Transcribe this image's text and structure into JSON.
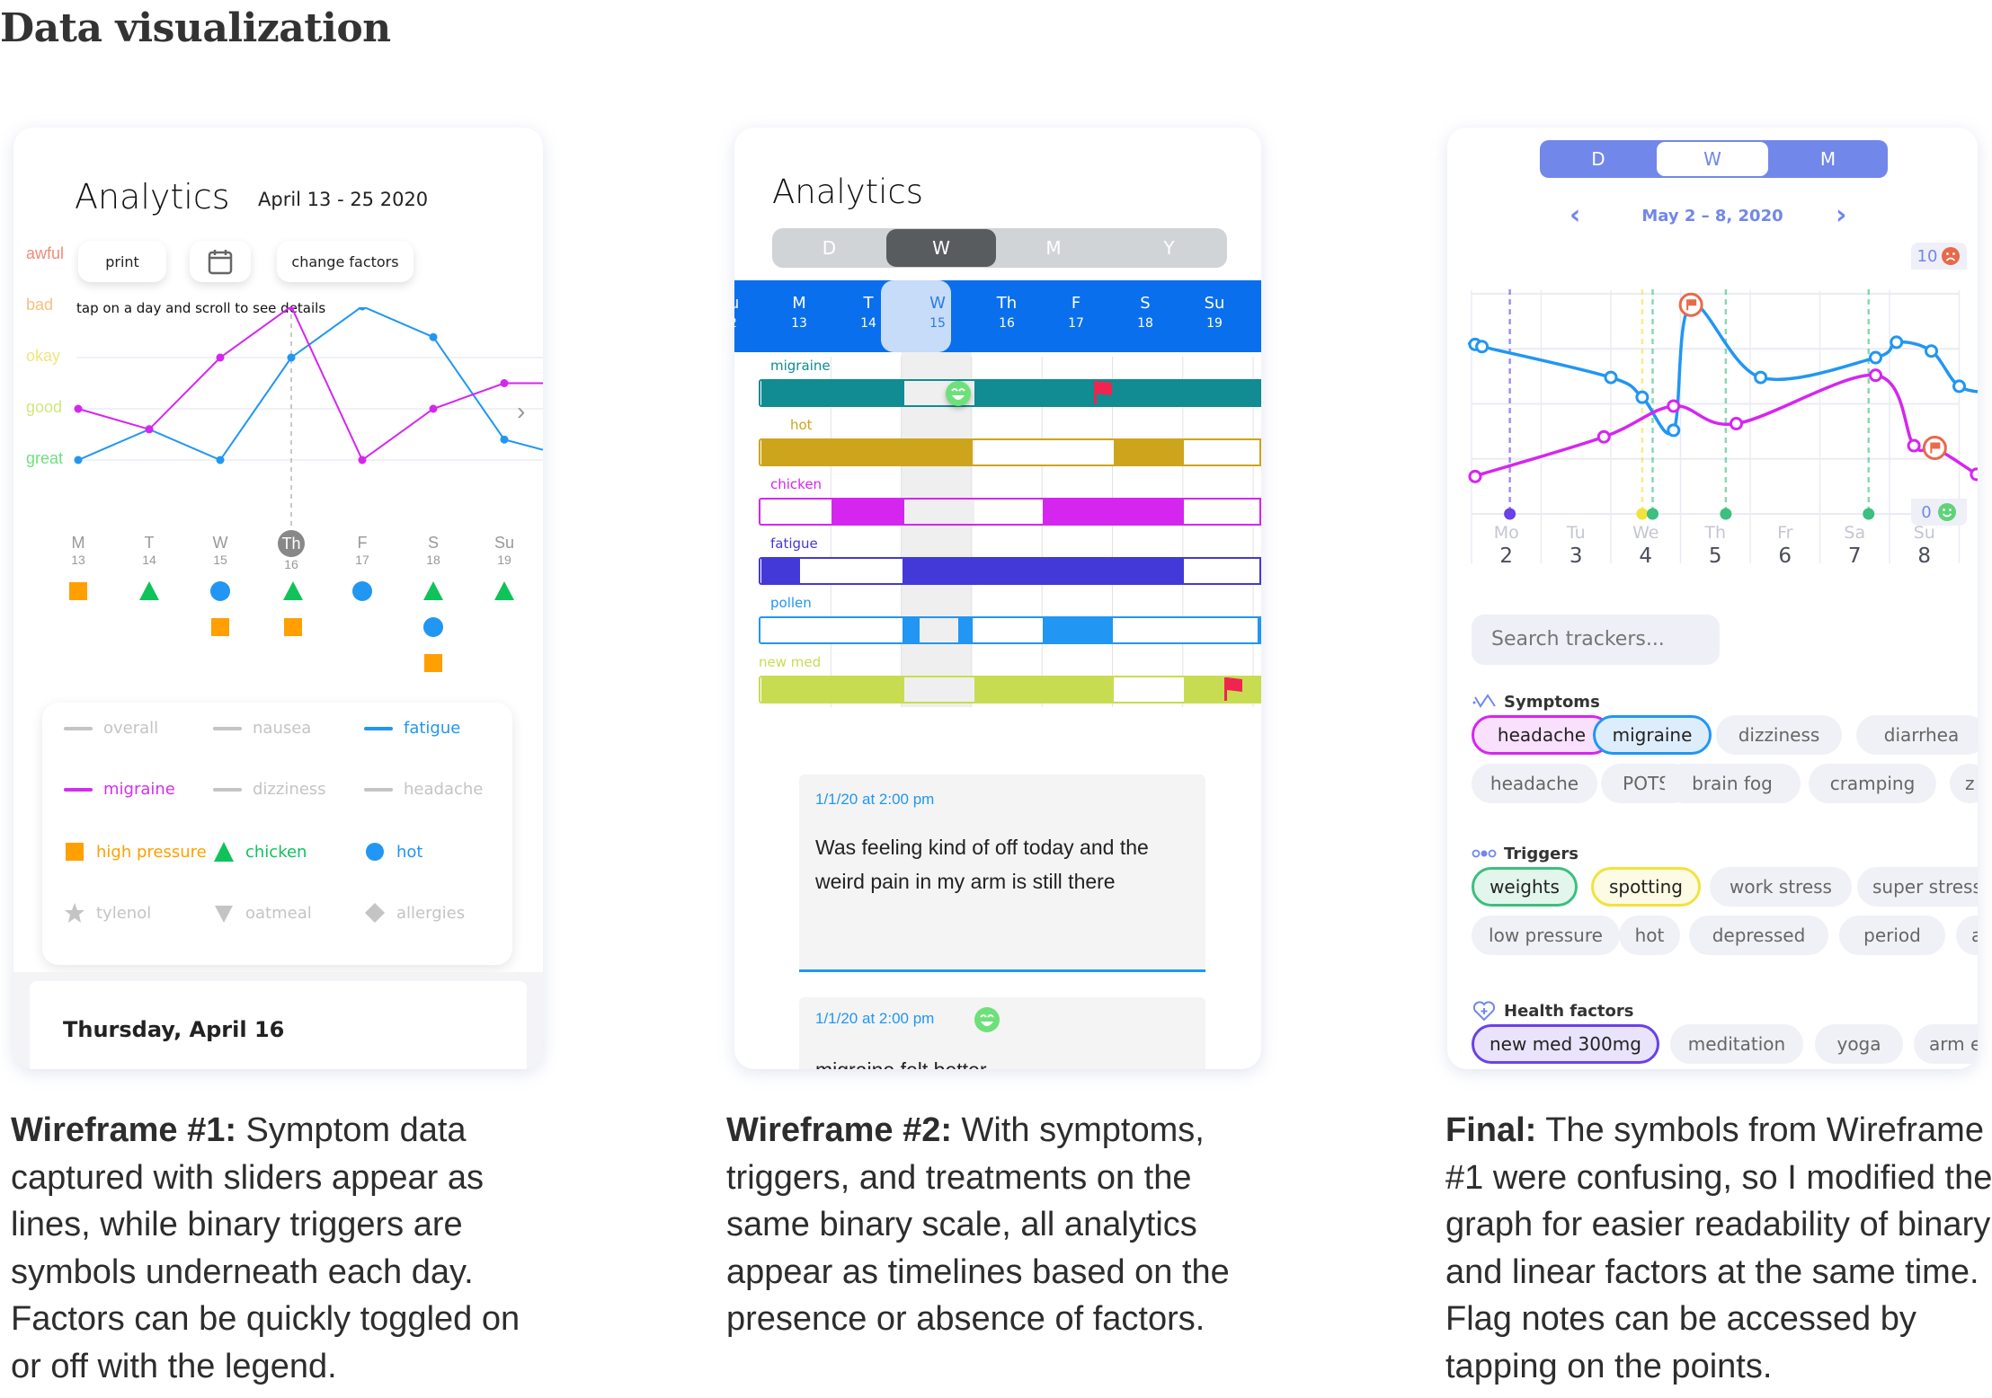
{
  "page": {
    "title": "Data visualization"
  },
  "wireframe1": {
    "title": "Analytics",
    "date_range": "April 13 - 25 2020",
    "buttons": {
      "print": "print",
      "calendar_icon": "calendar-icon",
      "change_factors": "change factors"
    },
    "hint": "tap on a day and scroll to see details",
    "scale": [
      {
        "label": "awful",
        "color": "#f28b7a"
      },
      {
        "label": "bad",
        "color": "#f7c07e"
      },
      {
        "label": "okay",
        "color": "#f2e47e"
      },
      {
        "label": "good",
        "color": "#cfe77a"
      },
      {
        "label": "great",
        "color": "#6fe07e"
      }
    ],
    "days": [
      {
        "d": "M",
        "n": "13"
      },
      {
        "d": "T",
        "n": "14"
      },
      {
        "d": "W",
        "n": "15"
      },
      {
        "d": "Th",
        "n": "16",
        "selected": true
      },
      {
        "d": "F",
        "n": "17"
      },
      {
        "d": "S",
        "n": "18"
      },
      {
        "d": "Su",
        "n": "19"
      }
    ],
    "day_symbols": [
      [
        "high pressure"
      ],
      [
        "chicken"
      ],
      [
        "hot",
        "high pressure"
      ],
      [
        "chicken",
        "high pressure"
      ],
      [
        "hot"
      ],
      [
        "chicken",
        "hot",
        "high pressure"
      ],
      [
        "chicken"
      ]
    ],
    "legend": [
      {
        "label": "overall",
        "kind": "line",
        "active": false,
        "color": "#c4c4c4"
      },
      {
        "label": "nausea",
        "kind": "line",
        "active": false,
        "color": "#c4c4c4"
      },
      {
        "label": "fatigue",
        "kind": "line",
        "active": true,
        "color": "#2196f3"
      },
      {
        "label": "migraine",
        "kind": "line",
        "active": true,
        "color": "#d32ef0"
      },
      {
        "label": "dizziness",
        "kind": "line",
        "active": false,
        "color": "#c4c4c4"
      },
      {
        "label": "headache",
        "kind": "line",
        "active": false,
        "color": "#c4c4c4"
      },
      {
        "label": "high pressure",
        "kind": "square",
        "active": true,
        "color": "#ff9f00"
      },
      {
        "label": "chicken",
        "kind": "triangle",
        "active": true,
        "color": "#0fc35a"
      },
      {
        "label": "hot",
        "kind": "circle",
        "active": true,
        "color": "#2196f3"
      },
      {
        "label": "tylenol",
        "kind": "star",
        "active": false,
        "color": "#c4c4c4"
      },
      {
        "label": "oatmeal",
        "kind": "down-triangle",
        "active": false,
        "color": "#c4c4c4"
      },
      {
        "label": "allergies",
        "kind": "diamond",
        "active": false,
        "color": "#c4c4c4"
      }
    ],
    "detail_title": "Thursday, April 16"
  },
  "wireframe2": {
    "title": "Analytics",
    "range_tabs": [
      "D",
      "W",
      "M",
      "Y"
    ],
    "active_tab": "W",
    "week": [
      {
        "d": "M",
        "n": "13"
      },
      {
        "d": "T",
        "n": "14"
      },
      {
        "d": "W",
        "n": "15",
        "selected": true
      },
      {
        "d": "Th",
        "n": "16"
      },
      {
        "d": "F",
        "n": "17"
      },
      {
        "d": "S",
        "n": "18"
      },
      {
        "d": "Su",
        "n": "19"
      }
    ],
    "timelines": [
      {
        "label": "migraine",
        "color": "#108c92"
      },
      {
        "label": "hot",
        "color": "#cda51c"
      },
      {
        "label": "chicken",
        "color": "#d526ef"
      },
      {
        "label": "fatigue",
        "color": "#4338d8"
      },
      {
        "label": "pollen",
        "color": "#2196f3"
      },
      {
        "label": "new med",
        "color": "#c8dc52"
      }
    ],
    "notes": [
      {
        "timestamp": "1/1/20 at 2:00 pm",
        "body": "Was feeling kind of off today and the weird pain in my arm is still there"
      },
      {
        "timestamp": "1/1/20 at 2:00 pm",
        "body": "migraine felt better",
        "mood": "happy-face-icon"
      }
    ]
  },
  "final": {
    "range_tabs": [
      "D",
      "W",
      "M"
    ],
    "active_tab": "W",
    "date_range": "May 2 – 8, 2020",
    "scale_max": {
      "value": "10",
      "icon": "sad-face-icon"
    },
    "scale_min": {
      "value": "0",
      "icon": "happy-face-icon"
    },
    "days": [
      {
        "d": "Mo",
        "n": "2"
      },
      {
        "d": "Tu",
        "n": "3"
      },
      {
        "d": "We",
        "n": "4"
      },
      {
        "d": "Th",
        "n": "5"
      },
      {
        "d": "Fr",
        "n": "6"
      },
      {
        "d": "Sa",
        "n": "7"
      },
      {
        "d": "Su",
        "n": "8"
      }
    ],
    "search_placeholder": "Search trackers...",
    "sections": [
      {
        "title": "Symptoms",
        "icon": "symptoms-icon",
        "chips": [
          {
            "label": "headache",
            "on": true,
            "color": "#d526ef",
            "bg": "#f9e0fd"
          },
          {
            "label": "migraine",
            "on": true,
            "color": "#2196f3",
            "bg": "#deedfc"
          },
          {
            "label": "dizziness"
          },
          {
            "label": "diarrhea"
          },
          {
            "label": "headache"
          },
          {
            "label": "POTS"
          },
          {
            "label": "brain fog"
          },
          {
            "label": "cramping"
          },
          {
            "label": "z"
          }
        ]
      },
      {
        "title": "Triggers",
        "icon": "triggers-icon",
        "chips": [
          {
            "label": "weights",
            "on": true,
            "color": "#3cbf7f",
            "bg": "#e3f6ec"
          },
          {
            "label": "spotting",
            "on": true,
            "color": "#f2e23e",
            "bg": "#fdfbe3"
          },
          {
            "label": "work stress"
          },
          {
            "label": "super stress"
          },
          {
            "label": "low pressure"
          },
          {
            "label": "hot"
          },
          {
            "label": "depressed"
          },
          {
            "label": "period"
          },
          {
            "label": "ar"
          }
        ]
      },
      {
        "title": "Health factors",
        "icon": "heart-plus-icon",
        "chips": [
          {
            "label": "new med 300mg",
            "on": true,
            "color": "#6a42e6",
            "bg": "#e9e4fb"
          },
          {
            "label": "meditation"
          },
          {
            "label": "yoga"
          },
          {
            "label": "arm e"
          }
        ]
      }
    ]
  },
  "captions": [
    {
      "bold": "Wireframe #1:",
      "text": " Symptom data captured with sliders appear as lines, while binary triggers are symbols underneath each day. Factors can be quickly toggled on or off with the legend."
    },
    {
      "bold": "Wireframe #2:",
      "text": " With symptoms, triggers, and treatments on the same binary scale, all analytics appear as timelines based on the presence or absence of factors."
    },
    {
      "bold": "Final:",
      "text": " The symbols from Wireframe #1 were confusing, so I modified the graph for easier readability of binary and linear factors at the same time. Flag notes can be accessed by tapping on the points."
    }
  ],
  "chart_data": [
    {
      "type": "line",
      "title": "Analytics (Wireframe #1)",
      "categories": [
        "M 13",
        "T 14",
        "W 15",
        "Th 16",
        "F 17",
        "S 18",
        "Su 19"
      ],
      "y_categories": [
        "great",
        "good",
        "okay",
        "bad",
        "awful"
      ],
      "ylim": [
        0,
        4
      ],
      "series": [
        {
          "name": "fatigue",
          "color": "#2196f3",
          "values": [
            0,
            0.6,
            0,
            2,
            3,
            2.4,
            0.4,
            0.2
          ]
        },
        {
          "name": "migraine",
          "color": "#d526ef",
          "values": [
            1,
            0.6,
            2,
            3,
            0,
            1,
            1.5,
            1.5
          ]
        }
      ],
      "x_extend": 7.4,
      "selected_category": "Th 16",
      "grid": true
    },
    {
      "type": "timeline",
      "title": "Analytics (Wireframe #2)",
      "categories": [
        "M 13",
        "T 14",
        "W 15",
        "Th 16",
        "F 17",
        "S 18",
        "Su 19"
      ],
      "selected_category": "W 15",
      "series": [
        {
          "name": "migraine",
          "presence": [
            [
              0,
              7.2
            ]
          ],
          "flags": [
            4.7
          ],
          "mood": [
            2.5
          ]
        },
        {
          "name": "hot",
          "presence": [
            [
              0,
              3
            ],
            [
              5,
              6
            ]
          ]
        },
        {
          "name": "chicken",
          "presence": [
            [
              1,
              2.77
            ],
            [
              4,
              6
            ]
          ]
        },
        {
          "name": "fatigue",
          "presence": [
            [
              0,
              0.55
            ],
            [
              2,
              6
            ]
          ]
        },
        {
          "name": "pollen",
          "presence": [
            [
              2,
              2.25
            ],
            [
              2.77,
              3
            ],
            [
              4,
              5
            ],
            [
              7.05,
              7.2
            ]
          ]
        },
        {
          "name": "new med",
          "presence": [
            [
              0,
              5
            ],
            [
              6,
              7.2
            ]
          ],
          "flags": [
            6.55
          ]
        }
      ]
    },
    {
      "type": "line",
      "title": "May 2 – 8, 2020",
      "categories": [
        "Mo 2",
        "Tu 3",
        "We 4",
        "Th 5",
        "Fr 6",
        "Sa 7",
        "Su 8"
      ],
      "ylim": [
        0,
        10
      ],
      "series": [
        {
          "name": "migraine",
          "color": "#2196f3",
          "points": [
            [
              -0.5,
              7.7
            ],
            [
              -0.35,
              7.6
            ],
            [
              1.5,
              6.2
            ],
            [
              1.95,
              5.3
            ],
            [
              2.4,
              3.8
            ],
            [
              3.65,
              6.2
            ],
            [
              5.3,
              7.1
            ],
            [
              5.6,
              7.8
            ],
            [
              6.1,
              7.4
            ],
            [
              6.5,
              5.8
            ],
            [
              7.0,
              5.5
            ]
          ],
          "flags": [
            [
              2.65,
              9.5
            ]
          ]
        },
        {
          "name": "headache",
          "color": "#d526ef",
          "points": [
            [
              -0.55,
              1.7
            ],
            [
              1.4,
              3.5
            ],
            [
              2.4,
              4.9
            ],
            [
              3.3,
              4.1
            ],
            [
              5.3,
              6.3
            ],
            [
              5.85,
              3.1
            ],
            [
              6.75,
              1.8
            ]
          ],
          "flags": [
            [
              6.15,
              3.0
            ]
          ]
        }
      ],
      "binary_markers": [
        {
          "name": "new med 300mg",
          "color": "#6a42e6",
          "x": 0.05
        },
        {
          "name": "spotting",
          "color": "#f2e23e",
          "x": 1.95
        },
        {
          "name": "weights",
          "color": "#3cbf7f",
          "x": 2.1
        },
        {
          "name": "weights",
          "color": "#3cbf7f",
          "x": 3.15
        },
        {
          "name": "weights",
          "color": "#3cbf7f",
          "x": 5.2
        }
      ],
      "grid": true
    }
  ]
}
